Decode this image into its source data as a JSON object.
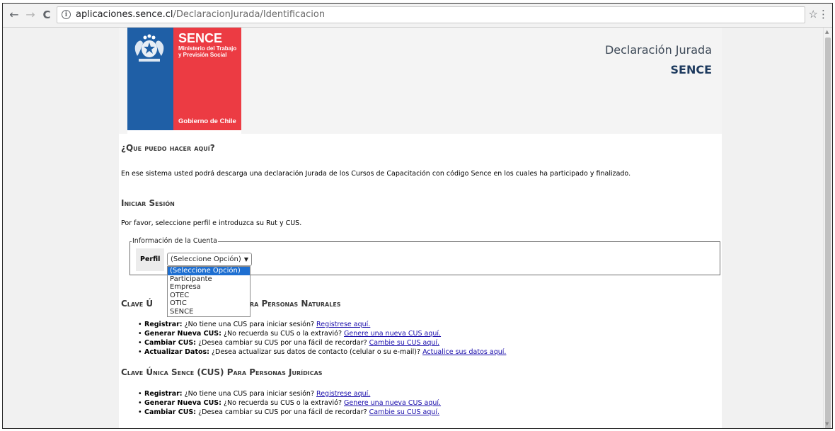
{
  "browser": {
    "url_domain": "aplicaciones.sence.cl",
    "url_path": "/DeclaracionJurada/Identificacion",
    "back_icon": "←",
    "forward_icon": "→",
    "reload_icon": "C",
    "info_icon": "i",
    "star_icon": "☆",
    "menu_icon": "⋮"
  },
  "header": {
    "logo_title": "SENCE",
    "logo_ministry_line1": "Ministerio del Trabajo",
    "logo_ministry_line2": "y Previsión Social",
    "logo_gobierno": "Gobierno de Chile",
    "title": "Declaración Jurada",
    "subtitle": "SENCE",
    "colors": {
      "logo_blue": "#1f5fa6",
      "logo_red": "#ec3b43",
      "title": "#1d3a5e"
    }
  },
  "intro": {
    "heading": "¿Que puedo hacer aquí?",
    "text": "En ese sistema usted podrá descarga una declaración Jurada de los Cursos de Capacitación con código Sence en los cuales ha participado y finalizado."
  },
  "login": {
    "heading": "Iniciar Sesión",
    "instructions": "Por favor, seleccione perfil e introduzca su Rut y CUS.",
    "legend": "Información de la Cuenta",
    "perfil_label": "Perfil",
    "select_value": "(Seleccione Opción)",
    "options": [
      "(Seleccione Opción)",
      "Participante",
      "Empresa",
      "OTEC",
      "OTIC",
      "SENCE"
    ]
  },
  "naturales": {
    "heading_visible_left": "Clave Ú",
    "heading_visible_right": "Para Personas Naturales",
    "items": [
      {
        "label": "Registrar:",
        "text_hidden_partial": "¿No tiene una CUS",
        "text": "para iniciar sesión?",
        "link": "Registrese aquí."
      },
      {
        "label": "Generar Nueva CUS:",
        "text": "¿No recuerda su CUS o la extravió?",
        "link": "Genere una nueva CUS aquí."
      },
      {
        "label": "Cambiar CUS:",
        "text": "¿Desea cambiar su CUS por una fácil de recordar?",
        "link": "Cambie su CUS aquí."
      },
      {
        "label": "Actualizar Datos:",
        "text": "¿Desea actualizar sus datos de contacto (celular o su e-mail)?",
        "link": "Actualice sus datos aquí."
      }
    ]
  },
  "juridicas": {
    "heading": "Clave Única Sence (CUS) Para Personas Jurídicas",
    "items": [
      {
        "label": "Registrar:",
        "text": "¿No tiene una CUS para iniciar sesión?",
        "link": "Registrese aquí."
      },
      {
        "label": "Generar Nueva CUS:",
        "text": "¿No recuerda su CUS o la extravió?",
        "link": "Genere una nueva CUS aquí."
      },
      {
        "label": "Cambiar CUS:",
        "text": "¿Desea cambiar su CUS por una fácil de recordar?",
        "link": "Cambie su CUS aquí."
      }
    ]
  }
}
